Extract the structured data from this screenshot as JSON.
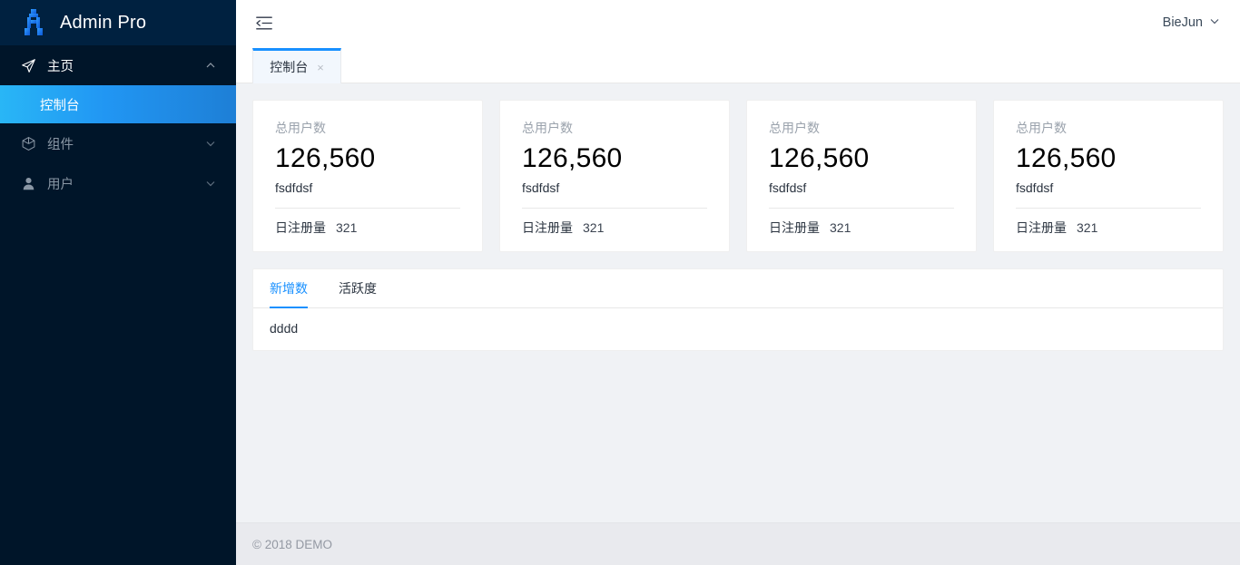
{
  "sidebar": {
    "logo": {
      "icon": "logo-a-mark",
      "title": "Admin Pro"
    },
    "menu": [
      {
        "label": "主页",
        "icon": "paper-plane-icon",
        "arrow": "chevron-up-icon",
        "expanded": true,
        "children": [
          {
            "label": "控制台",
            "active": true
          }
        ]
      },
      {
        "label": "组件",
        "icon": "cube-icon",
        "arrow": "chevron-down-icon",
        "expanded": false,
        "children": []
      },
      {
        "label": "用户",
        "icon": "user-icon",
        "arrow": "chevron-down-icon",
        "expanded": false,
        "children": []
      }
    ]
  },
  "topbar": {
    "fold_icon": "menu-fold-icon",
    "user": {
      "name": "BieJun",
      "arrow": "chevron-down-icon"
    }
  },
  "tabbar": {
    "tabs": [
      {
        "label": "控制台",
        "close": "×",
        "active": true
      }
    ]
  },
  "cards": [
    {
      "label": "总用户数",
      "value": "126,560",
      "sub": "fsdfdsf",
      "footer_label": "日注册量",
      "footer_value": "321"
    },
    {
      "label": "总用户数",
      "value": "126,560",
      "sub": "fsdfdsf",
      "footer_label": "日注册量",
      "footer_value": "321"
    },
    {
      "label": "总用户数",
      "value": "126,560",
      "sub": "fsdfdsf",
      "footer_label": "日注册量",
      "footer_value": "321"
    },
    {
      "label": "总用户数",
      "value": "126,560",
      "sub": "fsdfdsf",
      "footer_label": "日注册量",
      "footer_value": "321"
    }
  ],
  "panel": {
    "tabs": [
      {
        "label": "新增数",
        "active": true
      },
      {
        "label": "活跃度",
        "active": false
      }
    ],
    "body": "dddd"
  },
  "footer": {
    "copyright": "© 2018 DEMO"
  },
  "colors": {
    "sidebar_bg": "#001529",
    "sidebar_header_bg": "#002140",
    "accent": "#1890ff",
    "active_gradient_from": "#29b6f6",
    "active_gradient_to": "#1e7fd6",
    "content_bg": "#f0f2f5",
    "footer_bg": "#e9eaee"
  }
}
